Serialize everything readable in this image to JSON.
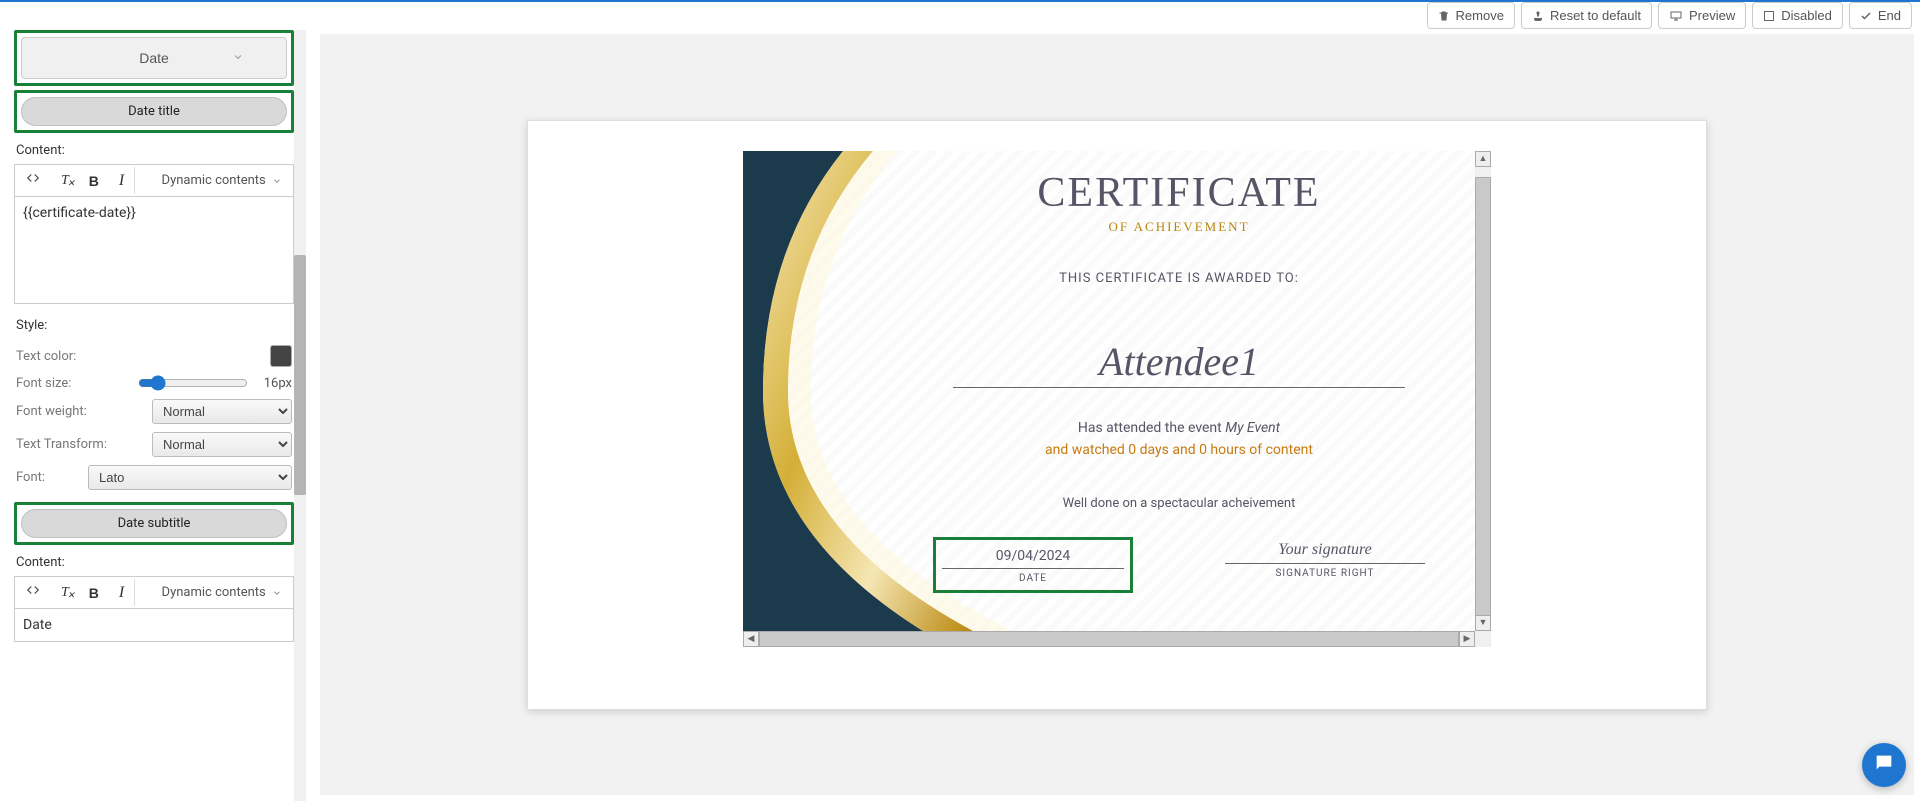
{
  "toolbar": {
    "remove": "Remove",
    "reset": "Reset to default",
    "preview": "Preview",
    "disabled": "Disabled",
    "end": "End"
  },
  "sidebar": {
    "date_dropdown": "Date",
    "date_title_pill": "Date title",
    "content_label": "Content:",
    "content_value": "{{certificate-date}}",
    "dynamic_contents": "Dynamic contents",
    "style_label": "Style:",
    "text_color_label": "Text color:",
    "text_color_hex": "#444444",
    "font_size_label": "Font size:",
    "font_size_value": "16px",
    "font_weight_label": "Font weight:",
    "font_weight_value": "Normal",
    "text_transform_label": "Text Transform:",
    "text_transform_value": "Normal",
    "font_label": "Font:",
    "font_value": "Lato",
    "date_subtitle_pill": "Date subtitle",
    "content_label_2": "Content:",
    "content_value_2": "Date"
  },
  "certificate": {
    "title": "CERTIFICATE",
    "subtitle": "OF ACHIEVEMENT",
    "awarded_to": "THIS CERTIFICATE IS AWARDED TO:",
    "attendee": "Attendee1",
    "attend_prefix": "Has attended the event ",
    "event_name": "My Event",
    "watched": "and watched 0 days and 0 hours of content",
    "well_done": "Well done on a spectacular acheivement",
    "date_value": "09/04/2024",
    "date_label": "DATE",
    "signature_value": "Your signature",
    "signature_label": "SIGNATURE RIGHT"
  }
}
